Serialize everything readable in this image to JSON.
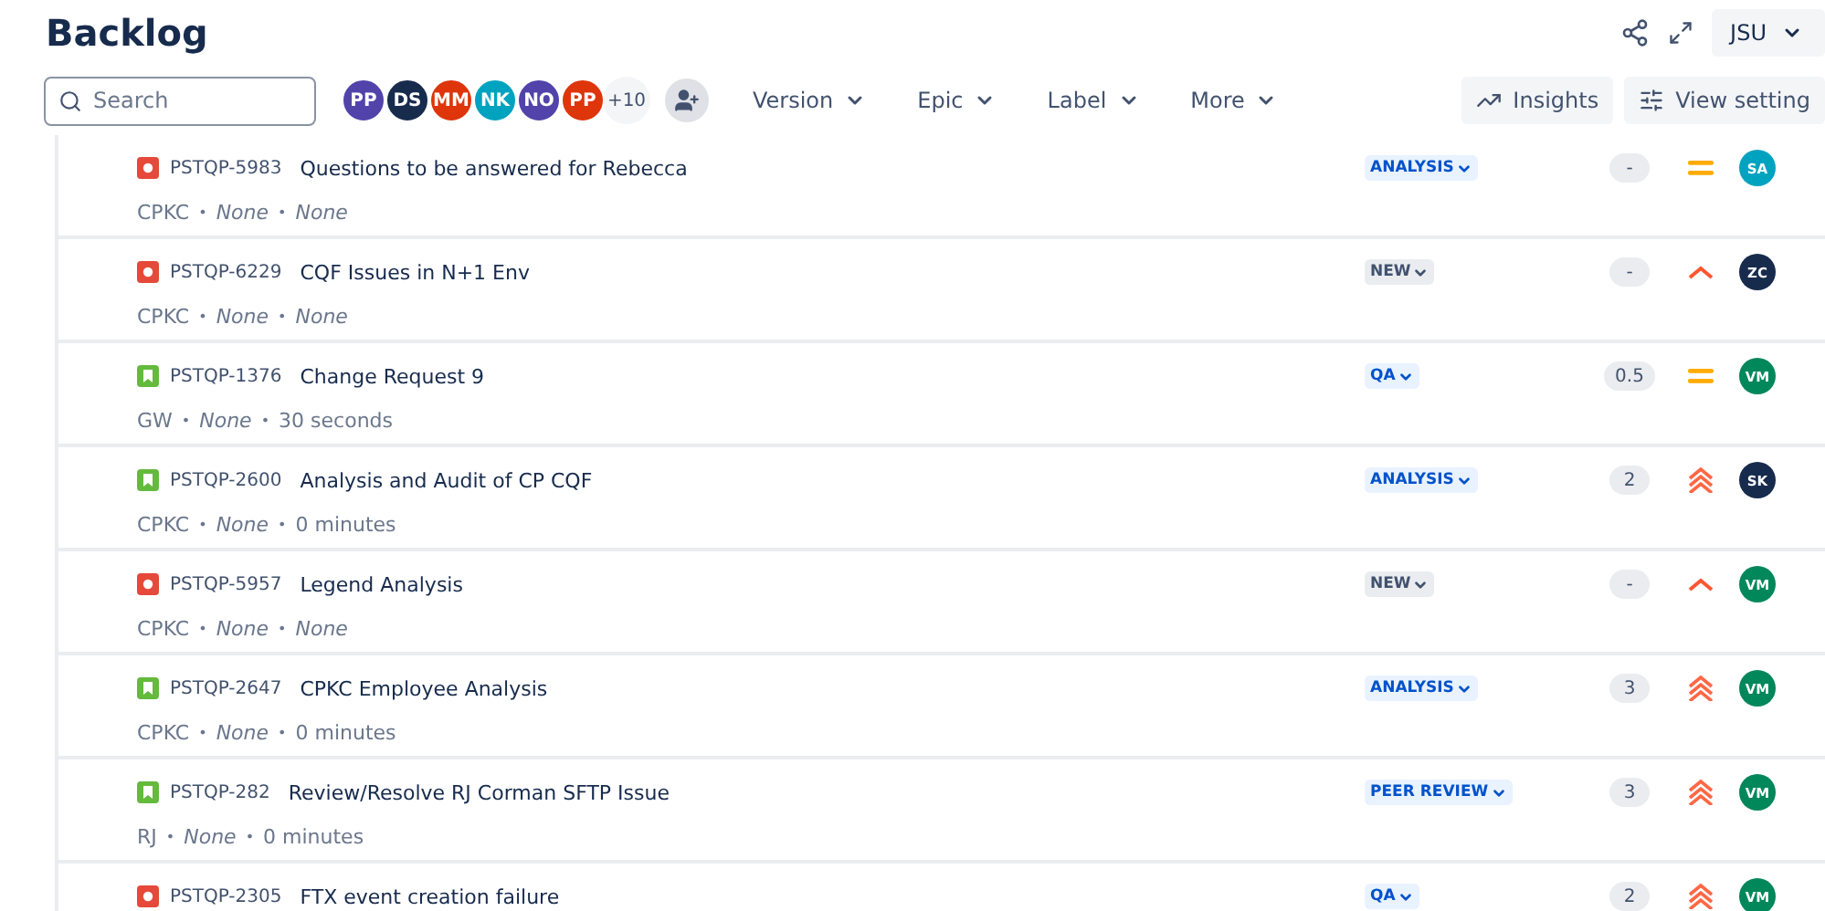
{
  "header": {
    "title": "Backlog",
    "project_button": "JSU"
  },
  "toolbar": {
    "search": {
      "placeholder": "Search"
    },
    "avatars": [
      {
        "initials": "PP",
        "color": "#5243aa"
      },
      {
        "initials": "DS",
        "color": "#172b4d"
      },
      {
        "initials": "MM",
        "color": "#de350b"
      },
      {
        "initials": "NK",
        "color": "#00a3bf"
      },
      {
        "initials": "NO",
        "color": "#5243aa"
      },
      {
        "initials": "PP",
        "color": "#de350b"
      }
    ],
    "more_avatars": "+10",
    "filters": [
      "Version",
      "Epic",
      "Label",
      "More"
    ],
    "buttons": [
      "Insights",
      "View setting"
    ]
  },
  "issues": [
    {
      "kind": "bug",
      "key": "PSTQP-5983",
      "summary": "Questions to be answered for Rebecca",
      "meta": [
        {
          "text": "CPKC",
          "kind": "plain"
        },
        {
          "separator": "•",
          "text": "None",
          "kind": "empty"
        },
        {
          "separator": "•",
          "text": "None",
          "kind": "empty"
        }
      ],
      "status": {
        "label": "ANALYSIS",
        "kind": "progress"
      },
      "estimate": "-",
      "priority": {
        "kind": "medium"
      },
      "assignee": {
        "initials": "SA",
        "color": "#00a3bf"
      }
    },
    {
      "kind": "bug",
      "key": "PSTQP-6229",
      "summary": "CQF Issues in N+1 Env",
      "meta": [
        {
          "text": "CPKC",
          "kind": "plain"
        },
        {
          "separator": "•",
          "text": "None",
          "kind": "empty"
        },
        {
          "separator": "•",
          "text": "None",
          "kind": "empty"
        }
      ],
      "status": {
        "label": "NEW",
        "kind": "new"
      },
      "estimate": "-",
      "priority": {
        "kind": "high"
      },
      "assignee": {
        "initials": "ZC",
        "color": "#172b4d"
      }
    },
    {
      "kind": "story",
      "key": "PSTQP-1376",
      "summary": "Change Request 9",
      "meta": [
        {
          "text": "GW",
          "kind": "plain"
        },
        {
          "separator": "•",
          "text": "None",
          "kind": "empty"
        },
        {
          "separator": "•",
          "text": "30 seconds",
          "kind": "plain"
        }
      ],
      "status": {
        "label": "QA",
        "kind": "progress"
      },
      "estimate": "0.5",
      "priority": {
        "kind": "medium"
      },
      "assignee": {
        "initials": "VM",
        "color": "#00875a"
      }
    },
    {
      "kind": "story",
      "key": "PSTQP-2600",
      "summary": "Analysis and Audit of CP CQF",
      "meta": [
        {
          "text": "CPKC",
          "kind": "plain"
        },
        {
          "separator": "•",
          "text": "None",
          "kind": "empty"
        },
        {
          "separator": "•",
          "text": "0 minutes",
          "kind": "plain"
        }
      ],
      "status": {
        "label": "ANALYSIS",
        "kind": "progress"
      },
      "estimate": "2",
      "priority": {
        "kind": "highest"
      },
      "assignee": {
        "initials": "SK",
        "color": "#172b4d"
      }
    },
    {
      "kind": "bug",
      "key": "PSTQP-5957",
      "summary": "Legend Analysis",
      "meta": [
        {
          "text": "CPKC",
          "kind": "plain"
        },
        {
          "separator": "•",
          "text": "None",
          "kind": "empty"
        },
        {
          "separator": "•",
          "text": "None",
          "kind": "empty"
        }
      ],
      "status": {
        "label": "NEW",
        "kind": "new"
      },
      "estimate": "-",
      "priority": {
        "kind": "high"
      },
      "assignee": {
        "initials": "VM",
        "color": "#00875a"
      }
    },
    {
      "kind": "story",
      "key": "PSTQP-2647",
      "summary": "CPKC Employee Analysis",
      "meta": [
        {
          "text": "CPKC",
          "kind": "plain"
        },
        {
          "separator": "•",
          "text": "None",
          "kind": "empty"
        },
        {
          "separator": "•",
          "text": "0 minutes",
          "kind": "plain"
        }
      ],
      "status": {
        "label": "ANALYSIS",
        "kind": "progress"
      },
      "estimate": "3",
      "priority": {
        "kind": "highest"
      },
      "assignee": {
        "initials": "VM",
        "color": "#00875a"
      }
    },
    {
      "kind": "story",
      "key": "PSTQP-282",
      "summary": "Review/Resolve RJ Corman SFTP Issue",
      "meta": [
        {
          "text": "RJ",
          "kind": "plain"
        },
        {
          "separator": "•",
          "text": "None",
          "kind": "empty"
        },
        {
          "separator": "•",
          "text": "0 minutes",
          "kind": "plain"
        }
      ],
      "status": {
        "label": "PEER REVIEW",
        "kind": "progress"
      },
      "estimate": "3",
      "priority": {
        "kind": "highest"
      },
      "assignee": {
        "initials": "VM",
        "color": "#00875a"
      }
    },
    {
      "kind": "bug",
      "key": "PSTQP-2305",
      "summary": "FTX event creation failure",
      "status": {
        "label": "QA",
        "kind": "progress"
      },
      "estimate": "2",
      "priority": {
        "kind": "highest"
      },
      "assignee": {
        "initials": "VM",
        "color": "#00875a"
      }
    }
  ]
}
